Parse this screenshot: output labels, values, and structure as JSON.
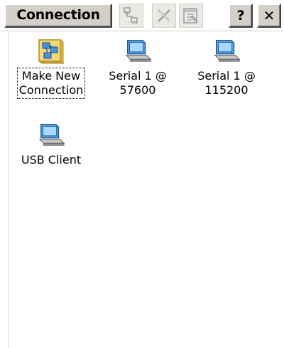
{
  "toolbar": {
    "title": "Connection",
    "buttons": [
      {
        "name": "properties-view-button",
        "icon": "network-properties-icon",
        "enabled": false
      },
      {
        "name": "delete-button",
        "icon": "delete-x-icon",
        "enabled": false
      },
      {
        "name": "properties-button",
        "icon": "properties-sheet-icon",
        "enabled": false
      },
      {
        "name": "help-button",
        "label": "?"
      },
      {
        "name": "close-button",
        "label": "✕"
      }
    ]
  },
  "items": [
    {
      "label": "Make New\nConnection",
      "icon": "make-new-connection-icon",
      "selected": true
    },
    {
      "label": "Serial 1 @\n57600",
      "icon": "connection-computer-icon",
      "selected": false
    },
    {
      "label": "Serial 1 @\n115200",
      "icon": "connection-computer-icon",
      "selected": false
    },
    {
      "label": "USB Client",
      "icon": "connection-computer-icon",
      "selected": false
    }
  ],
  "colors": {
    "button_face": "#d4d0c8",
    "window_background": "#ffffff"
  }
}
